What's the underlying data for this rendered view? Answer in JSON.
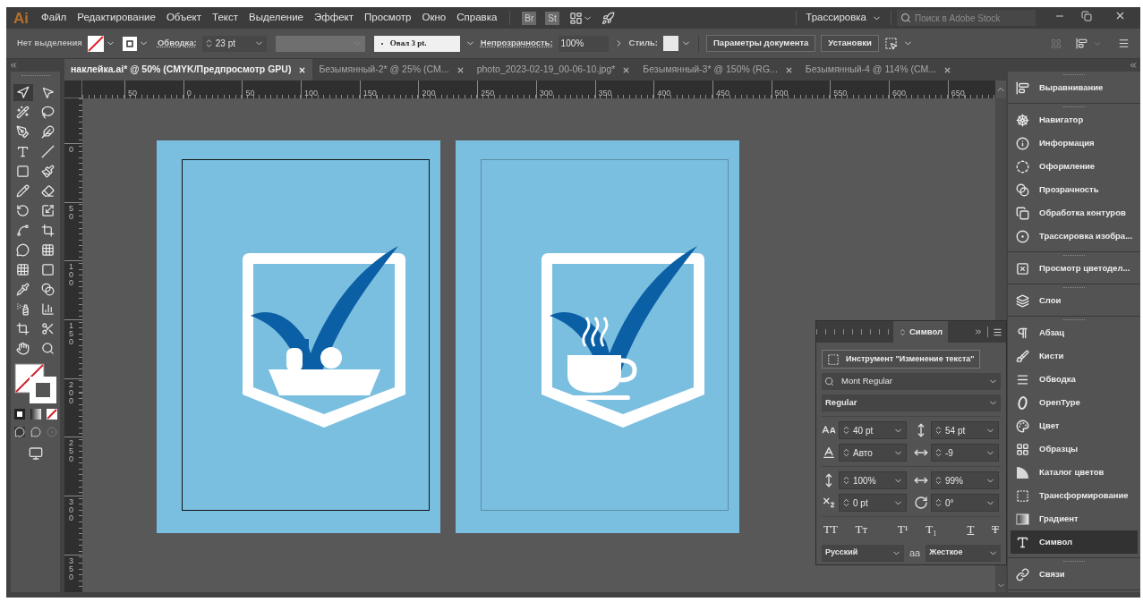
{
  "app_logo": "Ai",
  "menu": [
    "Файл",
    "Редактирование",
    "Объект",
    "Текст",
    "Выделение",
    "Эффект",
    "Просмотр",
    "Окно",
    "Справка"
  ],
  "bridge_badges": [
    "Br",
    "St"
  ],
  "workspace": "Трассировка",
  "stock_search": {
    "placeholder": "Поиск в Adobe Stock"
  },
  "control_bar": {
    "selection": "Нет выделения",
    "stroke_label": "Обводка:",
    "stroke_value": "23 pt",
    "brush": "Овал 3 pt.",
    "opacity_label": "Непрозрачность:",
    "opacity_value": "100%",
    "style_label": "Стиль:",
    "buttons": [
      "Параметры документа",
      "Установки"
    ]
  },
  "tabs": [
    {
      "label": "наклейка.ai* @ 50% (CMYK/Предпросмотр GPU)",
      "selected": true
    },
    {
      "label": "Безымянный-2* @ 25% (CM...",
      "selected": false
    },
    {
      "label": "photo_2023-02-19_00-06-10.jpg*",
      "selected": false
    },
    {
      "label": "Безымянный-3* @ 150% (RG...",
      "selected": false
    },
    {
      "label": "Безымянный-4 @ 114% (CM...",
      "selected": false
    }
  ],
  "ruler": {
    "horizontal": [
      "50",
      "0",
      "50",
      "100",
      "150",
      "200",
      "250",
      "300",
      "350",
      "400",
      "450",
      "500",
      "550",
      "600",
      "650"
    ],
    "vertical": [
      "0",
      "50",
      "100",
      "150",
      "200",
      "250",
      "300",
      "350"
    ]
  },
  "tools": [
    {
      "selected": true
    },
    {
      "selected": false
    },
    {
      "selected": false
    },
    {
      "selected": false
    },
    {
      "selected": false
    },
    {
      "selected": false
    },
    {
      "selected": false
    },
    {
      "selected": false
    },
    {
      "selected": false
    },
    {
      "selected": false
    },
    {
      "selected": false
    },
    {
      "selected": false
    },
    {
      "selected": false
    },
    {
      "selected": false
    },
    {
      "selected": false
    },
    {
      "selected": false
    },
    {
      "selected": false
    },
    {
      "selected": false
    },
    {
      "selected": false
    },
    {
      "selected": false
    },
    {
      "selected": false
    },
    {
      "selected": false
    },
    {
      "selected": false
    },
    {
      "selected": false
    },
    {
      "selected": false
    },
    {
      "selected": false
    }
  ],
  "artboards": [
    {
      "kind": "basket",
      "selected": true
    },
    {
      "kind": "cup",
      "selected": false
    }
  ],
  "panel_groups": [
    {
      "items": [
        {
          "label": "Выравнивание",
          "selected": false
        }
      ]
    },
    {
      "items": [
        {
          "label": "Навигатор",
          "selected": false
        },
        {
          "label": "Информация",
          "selected": false
        },
        {
          "label": "Оформление",
          "selected": false
        },
        {
          "label": "Прозрачность",
          "selected": false
        },
        {
          "label": "Обработка контуров",
          "selected": false
        },
        {
          "label": "Трассировка изобра...",
          "selected": false
        }
      ]
    },
    {
      "items": [
        {
          "label": "Просмотр цветодел...",
          "selected": false
        }
      ]
    },
    {
      "items": [
        {
          "label": "Слои",
          "selected": false
        }
      ]
    },
    {
      "items": [
        {
          "label": "Абзац",
          "selected": false
        },
        {
          "label": "Кисти",
          "selected": false
        },
        {
          "label": "Обводка",
          "selected": false
        },
        {
          "label": "OpenType",
          "selected": false
        },
        {
          "label": "Цвет",
          "selected": false
        },
        {
          "label": "Образцы",
          "selected": false
        },
        {
          "label": "Каталог цветов",
          "selected": false
        },
        {
          "label": "Трансформирование",
          "selected": false
        },
        {
          "label": "Градиент",
          "selected": false
        },
        {
          "label": "Символ",
          "selected": true
        }
      ]
    },
    {
      "items": [
        {
          "label": "Связи",
          "selected": false
        }
      ]
    }
  ],
  "character_panel": {
    "title": "Символ",
    "touch_type_button": "Инструмент \"Изменение текста\"",
    "font_family": "Mont Regular",
    "font_style": "Regular",
    "fields": [
      {
        "value": "40 pt"
      },
      {
        "value": "54 pt"
      },
      {
        "value": "Авто"
      },
      {
        "value": "-9"
      },
      {
        "value": "100%"
      },
      {
        "value": "99%"
      },
      {
        "value": "0 pt"
      },
      {
        "value": "0°"
      }
    ],
    "type_buttons": [
      {
        "glyph": "TT",
        "kind": "caps"
      },
      {
        "glyph": "Tт",
        "kind": "smallcaps"
      },
      {
        "glyph": "T¹",
        "kind": "super"
      },
      {
        "glyph": "T₁",
        "kind": "sub"
      },
      {
        "glyph": "T",
        "kind": "underline"
      },
      {
        "glyph": "T",
        "kind": "strike"
      }
    ],
    "language": "Русский",
    "antialias_glyph": "aa",
    "antialiasing": "Жесткое"
  }
}
